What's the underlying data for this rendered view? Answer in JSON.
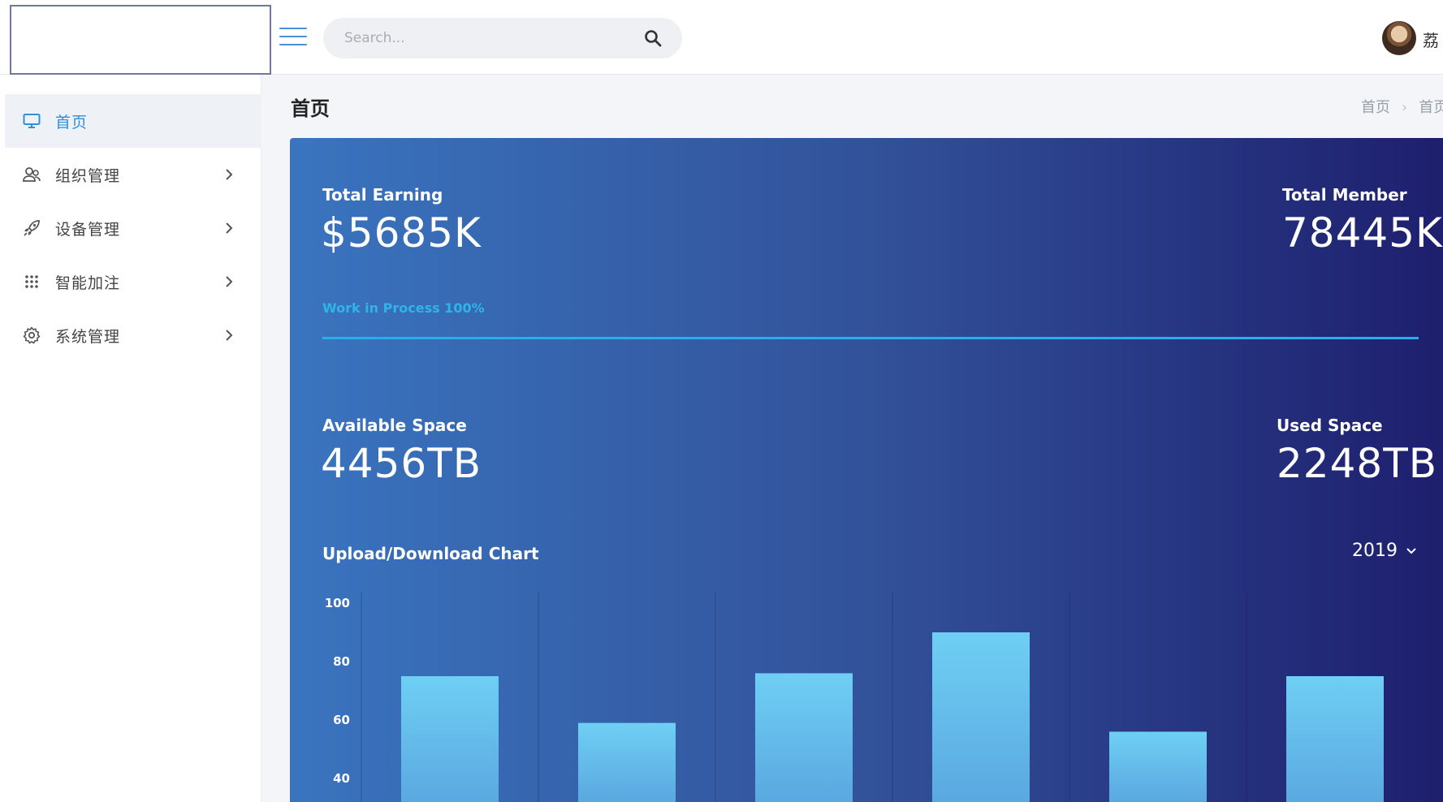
{
  "header": {
    "search_placeholder": "Search...",
    "username": "荔"
  },
  "sidebar": {
    "items": [
      {
        "label": "首页",
        "icon": "monitor-icon",
        "active": true
      },
      {
        "label": "组织管理",
        "icon": "users-icon"
      },
      {
        "label": "设备管理",
        "icon": "rocket-icon"
      },
      {
        "label": "智能加注",
        "icon": "grid-dots-icon"
      },
      {
        "label": "系统管理",
        "icon": "gear-icon"
      }
    ]
  },
  "page": {
    "title": "首页",
    "breadcrumb": [
      "首页",
      "首页"
    ]
  },
  "stats": {
    "total_earning_label": "Total Earning",
    "total_earning_value": "$5685K",
    "total_member_label": "Total Member",
    "total_member_value": "78445K",
    "available_space_label": "Available Space",
    "available_space_value": "4456TB",
    "used_space_label": "Used Space",
    "used_space_value": "2248TB",
    "progress_label": "Work in Process 100%",
    "progress_fraction": 1.0
  },
  "chart": {
    "title": "Upload/Download Chart",
    "year": "2019"
  },
  "colors": {
    "accent": "#2f8fd8",
    "bar": "#6fcff4",
    "progress": "#28aee8"
  },
  "chart_data": {
    "type": "bar",
    "title": "Upload/Download Chart",
    "categories": [
      "",
      "",
      "",
      "",
      "",
      ""
    ],
    "values": [
      75,
      59,
      76,
      90,
      56,
      75
    ],
    "ylim": [
      20,
      100
    ],
    "yticks": [
      40,
      60,
      80,
      100
    ],
    "grid": "vertical"
  }
}
